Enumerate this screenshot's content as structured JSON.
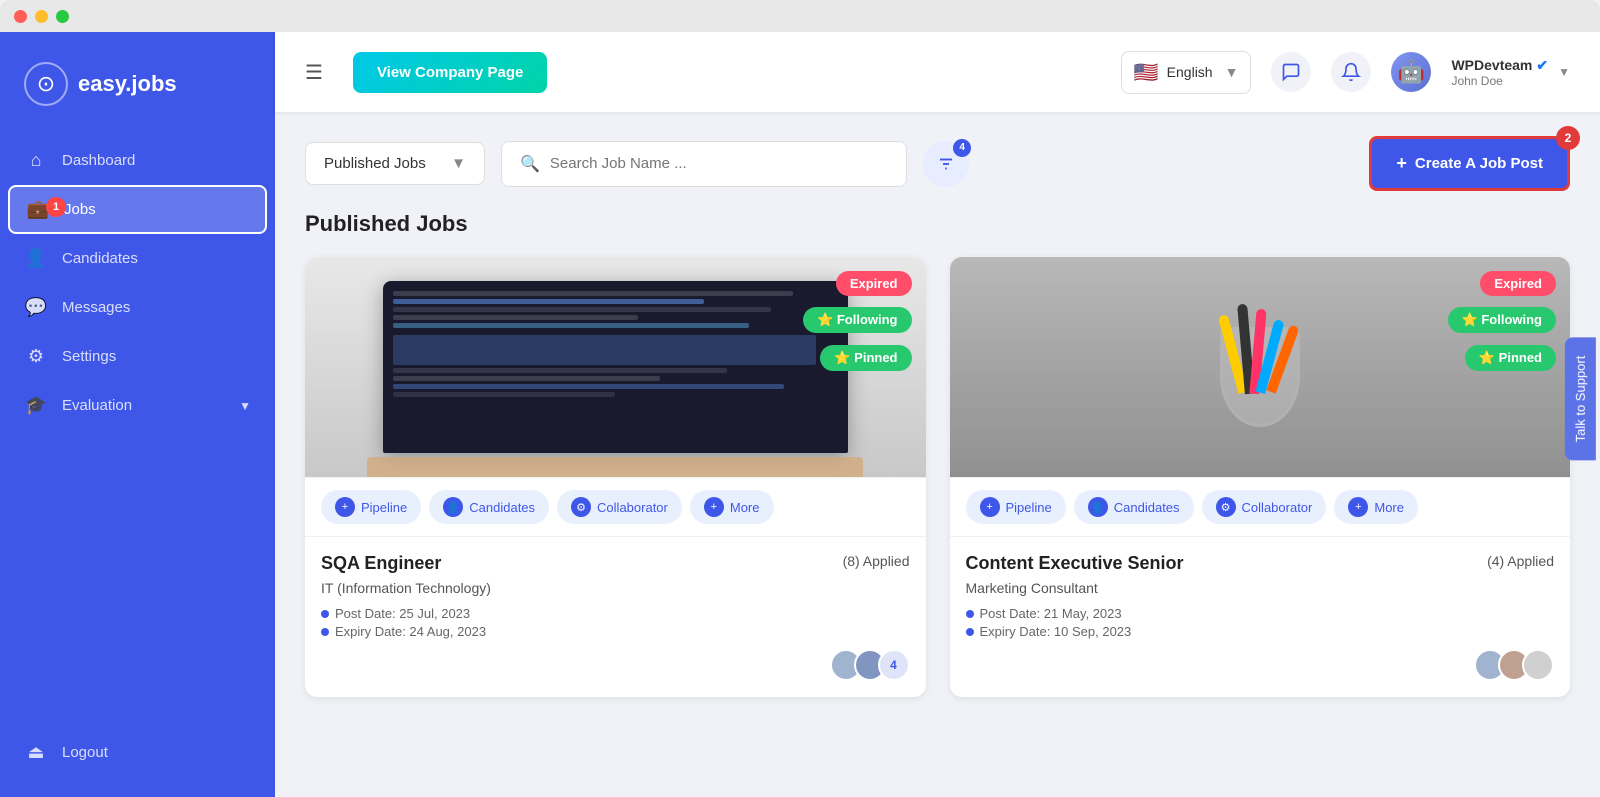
{
  "window": {
    "dots": [
      "red",
      "yellow",
      "green"
    ]
  },
  "sidebar": {
    "logo": {
      "icon": "⊙",
      "text": "easy.jobs"
    },
    "items": [
      {
        "id": "dashboard",
        "label": "Dashboard",
        "icon": "⌂",
        "active": false,
        "badge": null
      },
      {
        "id": "jobs",
        "label": "Jobs",
        "icon": "💼",
        "active": true,
        "badge": "1"
      },
      {
        "id": "candidates",
        "label": "Candidates",
        "icon": "👤",
        "active": false,
        "badge": null
      },
      {
        "id": "messages",
        "label": "Messages",
        "icon": "💬",
        "active": false,
        "badge": null
      },
      {
        "id": "settings",
        "label": "Settings",
        "icon": "⚙",
        "active": false,
        "badge": null
      },
      {
        "id": "evaluation",
        "label": "Evaluation",
        "icon": "🎓",
        "active": false,
        "badge": null,
        "hasChevron": true
      }
    ],
    "logout": {
      "label": "Logout",
      "icon": "⏏"
    }
  },
  "header": {
    "view_company_btn": "View Company Page",
    "language": "English",
    "user": {
      "name": "WPDevteam",
      "role": "John Doe",
      "verified": true
    },
    "filter_count": 4
  },
  "toolbar": {
    "filter_dropdown_label": "Published Jobs",
    "search_placeholder": "Search Job Name ...",
    "create_btn_label": "Create A Job Post",
    "create_btn_badge": "2",
    "filter_badge": "4"
  },
  "content": {
    "section_title": "Published Jobs",
    "jobs": [
      {
        "id": "sqa-engineer",
        "title": "SQA Engineer",
        "category": "IT (Information Technology)",
        "applied_count": "(8) Applied",
        "post_date": "Post Date: 25 Jul, 2023",
        "expiry_date": "Expiry Date: 24 Aug, 2023",
        "status": "Expired",
        "is_following": true,
        "is_pinned": true,
        "avatar_count": "4",
        "actions": [
          "Pipeline",
          "Candidates",
          "Collaborator",
          "More"
        ],
        "image_type": "laptop"
      },
      {
        "id": "content-executive",
        "title": "Content Executive Senior",
        "category": "Marketing Consultant",
        "applied_count": "(4) Applied",
        "post_date": "Post Date: 21 May, 2023",
        "expiry_date": "Expiry Date: 10 Sep, 2023",
        "status": "Expired",
        "is_following": true,
        "is_pinned": true,
        "avatar_count": "3",
        "actions": [
          "Pipeline",
          "Candidates",
          "Collaborator",
          "More"
        ],
        "image_type": "pens"
      }
    ]
  },
  "support_tab": "Talk to Support"
}
